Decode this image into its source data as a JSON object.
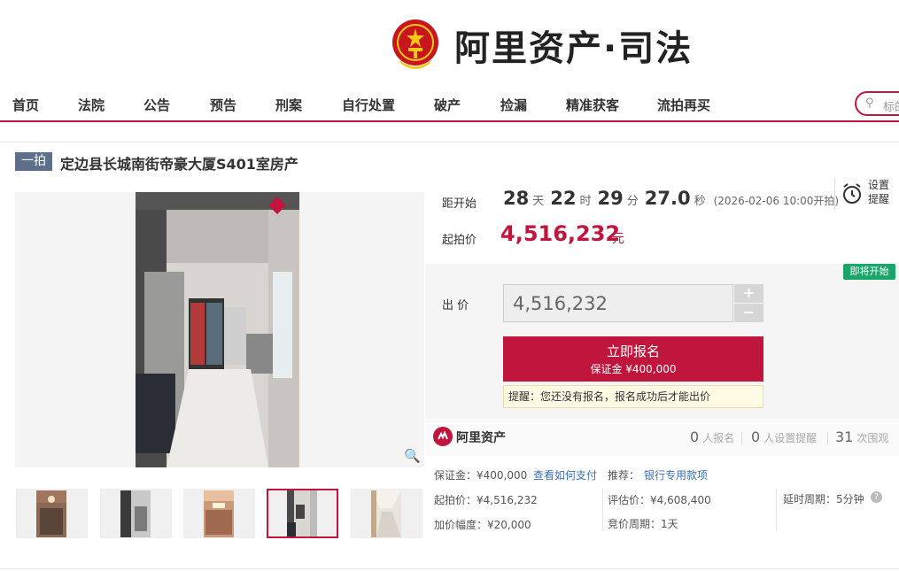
{
  "header": {
    "logo_text": "阿里资产·司法"
  },
  "nav": {
    "items": [
      "首页",
      "法院",
      "公告",
      "预告",
      "刑案",
      "自行处置",
      "破产",
      "捡漏",
      "精准获客",
      "流拍再买"
    ]
  },
  "search": {
    "placeholder": "标的"
  },
  "item": {
    "tag": "一拍",
    "title": "定边县长城南街帝豪大厦S401室房产"
  },
  "countdown": {
    "label": "距开始",
    "days": "28",
    "days_unit": "天",
    "hours": "22",
    "hours_unit": "时",
    "minutes": "29",
    "minutes_unit": "分",
    "seconds": "27.0",
    "seconds_unit": "秒",
    "start_text": "(2026-02-06 10:00开拍)"
  },
  "reminder": {
    "label": "设置提醒"
  },
  "price": {
    "label": "起拍价",
    "value": "4,516,232",
    "unit": "元"
  },
  "bid": {
    "status_badge": "即将开始",
    "label": "出 价",
    "value": "4,516,232",
    "plus": "+",
    "minus": "−",
    "signup_label": "立即报名",
    "deposit_label": "保证金 ¥400,000",
    "tip": "提醒：您还没有报名，报名成功后才能出价"
  },
  "stats": {
    "brand": "阿里资产",
    "signups": "0",
    "signups_label": "人报名",
    "reminders": "0",
    "reminders_label": "人设置提醒",
    "views": "31",
    "views_label": "次围观"
  },
  "details": {
    "deposit": "保证金：¥400,000",
    "how_to_pay": "查看如何支付",
    "recommend_label": "推荐：",
    "recommend_link": "银行专用款项",
    "start_price": "起拍价：¥4,516,232",
    "appraisal": "评估价：¥4,608,400",
    "delay": "延时周期：5分钟",
    "increment": "加价幅度：¥20,000",
    "period": "竞价周期：1天"
  },
  "colors": {
    "accent": "#c0163e",
    "tag": "#5d6f8c",
    "badge": "#1aa56a",
    "link": "#3a6fb0"
  }
}
